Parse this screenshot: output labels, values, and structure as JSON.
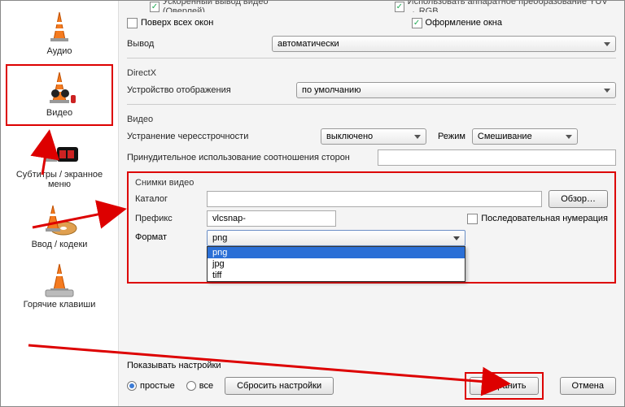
{
  "sidebar": {
    "items": [
      {
        "label": "Аудио"
      },
      {
        "label": "Видео"
      },
      {
        "label": "Субтитры / экранное меню"
      },
      {
        "label": "Ввод / кодеки"
      },
      {
        "label": "Горячие клавиши"
      }
    ]
  },
  "top_truncated": {
    "left": "Ускоренный вывод видео (Оверлей)",
    "right": "Использовать аппаратное преобразование YUV → RGB"
  },
  "checkboxes": {
    "on_top": {
      "label": "Поверх всех окон",
      "checked": false
    },
    "decor": {
      "label": "Оформление окна",
      "checked": true
    },
    "sequential_numbering": {
      "label": "Последовательная нумерация",
      "checked": false
    }
  },
  "rows": {
    "output_label": "Вывод",
    "output_value": "автоматически",
    "directx_section": "DirectX",
    "display_device_label": "Устройство отображения",
    "display_device_value": "по умолчанию",
    "video_section": "Видео",
    "deinterlace_label": "Устранение чересстрочности",
    "deinterlace_value": "выключено",
    "mode_label": "Режим",
    "mode_value": "Смешивание",
    "aspect_label": "Принудительное использование соотношения сторон",
    "aspect_value": ""
  },
  "snapshot": {
    "title": "Снимки видео",
    "catalog_label": "Каталог",
    "catalog_value": "",
    "browse_button": "Обзор…",
    "prefix_label": "Префикс",
    "prefix_value": "vlcsnap-",
    "format_label": "Формат",
    "format_value": "png",
    "format_options": [
      "png",
      "jpg",
      "tiff"
    ]
  },
  "footer": {
    "show_settings_label": "Показывать настройки",
    "radio_simple": "простые",
    "radio_all": "все",
    "reset_button": "Сбросить настройки",
    "save_button": "Сохранить",
    "cancel_button": "Отмена"
  }
}
